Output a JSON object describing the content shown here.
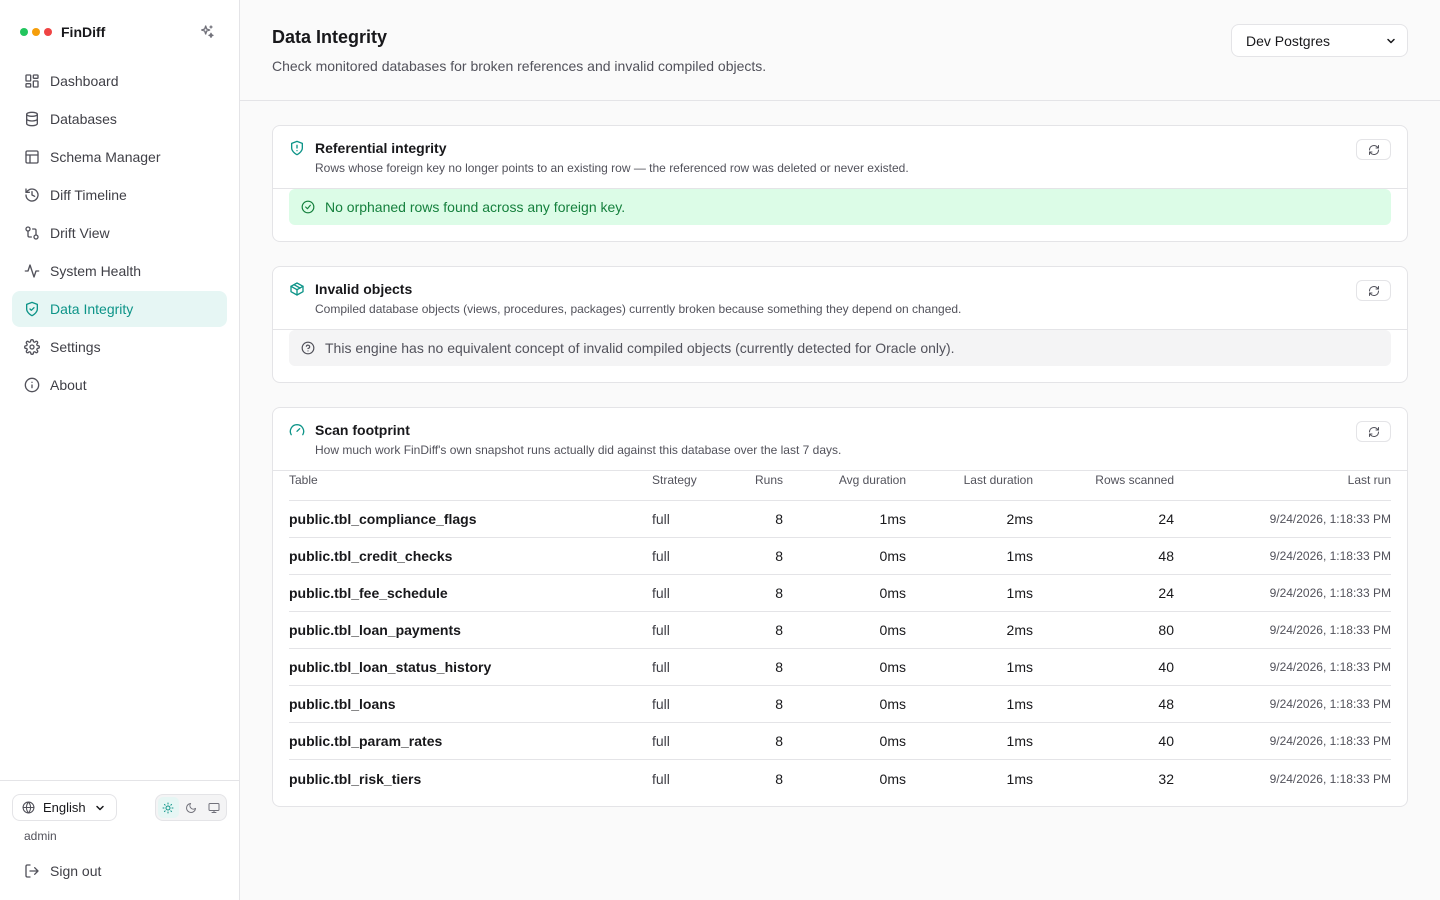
{
  "app": {
    "name": "FinDiff"
  },
  "brand": {
    "dot_colors": [
      "#22c55e",
      "#f59e0b",
      "#ef4444"
    ]
  },
  "sidebar": {
    "items": [
      {
        "label": "Dashboard",
        "icon": "dashboard-icon"
      },
      {
        "label": "Databases",
        "icon": "database-icon"
      },
      {
        "label": "Schema Manager",
        "icon": "table-icon"
      },
      {
        "label": "Diff Timeline",
        "icon": "history-icon"
      },
      {
        "label": "Drift View",
        "icon": "git-compare-icon"
      },
      {
        "label": "System Health",
        "icon": "activity-icon"
      },
      {
        "label": "Data Integrity",
        "icon": "shield-check-icon",
        "active": true
      },
      {
        "label": "Settings",
        "icon": "gear-icon"
      },
      {
        "label": "About",
        "icon": "info-icon"
      }
    ],
    "language": "English",
    "user": "admin",
    "signout": "Sign out"
  },
  "header": {
    "title": "Data Integrity",
    "subtitle": "Check monitored databases for broken references and invalid compiled objects.",
    "db_selected": "Dev Postgres"
  },
  "referential": {
    "title": "Referential integrity",
    "desc": "Rows whose foreign key no longer points to an existing row — the referenced row was deleted or never existed.",
    "message": "No orphaned rows found across any foreign key."
  },
  "invalid": {
    "title": "Invalid objects",
    "desc": "Compiled database objects (views, procedures, packages) currently broken because something they depend on changed.",
    "message": "This engine has no equivalent concept of invalid compiled objects (currently detected for Oracle only)."
  },
  "scan": {
    "title": "Scan footprint",
    "desc": "How much work FinDiff's own snapshot runs actually did against this database over the last 7 days.",
    "columns": {
      "table": "Table",
      "strategy": "Strategy",
      "runs": "Runs",
      "avg": "Avg duration",
      "last": "Last duration",
      "rows": "Rows scanned",
      "last_run": "Last run"
    },
    "rows": [
      {
        "table": "public.tbl_compliance_flags",
        "strategy": "full",
        "runs": "8",
        "avg": "1ms",
        "last": "2ms",
        "rows": "24",
        "last_run": "9/24/2026, 1:18:33 PM"
      },
      {
        "table": "public.tbl_credit_checks",
        "strategy": "full",
        "runs": "8",
        "avg": "0ms",
        "last": "1ms",
        "rows": "48",
        "last_run": "9/24/2026, 1:18:33 PM"
      },
      {
        "table": "public.tbl_fee_schedule",
        "strategy": "full",
        "runs": "8",
        "avg": "0ms",
        "last": "1ms",
        "rows": "24",
        "last_run": "9/24/2026, 1:18:33 PM"
      },
      {
        "table": "public.tbl_loan_payments",
        "strategy": "full",
        "runs": "8",
        "avg": "0ms",
        "last": "2ms",
        "rows": "80",
        "last_run": "9/24/2026, 1:18:33 PM"
      },
      {
        "table": "public.tbl_loan_status_history",
        "strategy": "full",
        "runs": "8",
        "avg": "0ms",
        "last": "1ms",
        "rows": "40",
        "last_run": "9/24/2026, 1:18:33 PM"
      },
      {
        "table": "public.tbl_loans",
        "strategy": "full",
        "runs": "8",
        "avg": "0ms",
        "last": "1ms",
        "rows": "48",
        "last_run": "9/24/2026, 1:18:33 PM"
      },
      {
        "table": "public.tbl_param_rates",
        "strategy": "full",
        "runs": "8",
        "avg": "0ms",
        "last": "1ms",
        "rows": "40",
        "last_run": "9/24/2026, 1:18:33 PM"
      },
      {
        "table": "public.tbl_risk_tiers",
        "strategy": "full",
        "runs": "8",
        "avg": "0ms",
        "last": "1ms",
        "rows": "32",
        "last_run": "9/24/2026, 1:18:33 PM"
      }
    ]
  },
  "colors": {
    "accent": "#0d9488",
    "ok_bg": "#dcfce7",
    "ok_text": "#15803d"
  }
}
